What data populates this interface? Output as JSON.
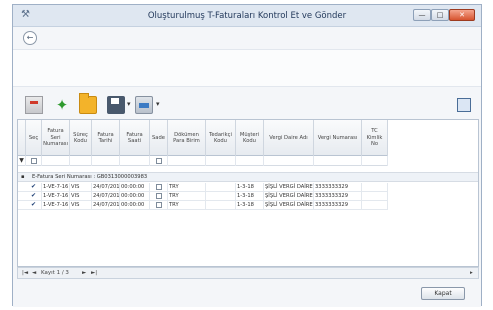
{
  "window": {
    "title": "Oluşturulmuş T-Faturaları Kontrol Et ve Gönder",
    "minimize_glyph": "—",
    "maximize_glyph": "□",
    "close_glyph": "✕",
    "app_icon": "wrench-icon"
  },
  "nav": {
    "back_glyph": "←",
    "back_icon": "back-arrow-icon"
  },
  "toolbar": {
    "items": [
      "document-icon",
      "run-icon",
      "folder-icon",
      "save-icon",
      "print-icon",
      "layout-icon"
    ],
    "dropdown_glyph": "▾"
  },
  "grid": {
    "columns": [
      "Seç",
      "Fatura Seri Numarası",
      "Süreç Kodu",
      "Fatura Tarihi",
      "Fatura Saati",
      "Sade",
      "Dökümen Para Birim",
      "Tedarikçi Kodu",
      "Müşteri Kodu",
      "Vergi Daire Adı",
      "Vergi Numarası",
      "TC Kimlik No"
    ],
    "filter_row_icon": "filter-icon",
    "group_label": "E-Fatura Seri Numarası : GB0313000003983",
    "rows": [
      [
        "✔",
        "1-VE-7-16",
        "VIS",
        "24/07/2013",
        "00:00:00",
        "",
        "TRY",
        "",
        "1-3-18",
        "ŞİŞLİ VERGİ DAİRESİ",
        "3333333329",
        ""
      ],
      [
        "✔",
        "1-VE-7-16",
        "VIS",
        "24/07/2013",
        "00:00:00",
        "",
        "TRY",
        "",
        "1-3-18",
        "ŞİŞLİ VERGİ DAİRESİ",
        "3333333329",
        ""
      ],
      [
        "✔",
        "1-VE-7-16",
        "VIS",
        "24/07/2013",
        "00:00:00",
        "",
        "TRY",
        "",
        "1-3-18",
        "ŞİŞLİ VERGİ DAİRESİ",
        "3333333329",
        ""
      ]
    ]
  },
  "pager": {
    "first": "|◄",
    "prev": "◄",
    "record_text": "Kayıt 1 / 3",
    "next": "►",
    "last": "►|",
    "end_glyph": "▸"
  },
  "footer": {
    "ok_label": "Kapat"
  }
}
